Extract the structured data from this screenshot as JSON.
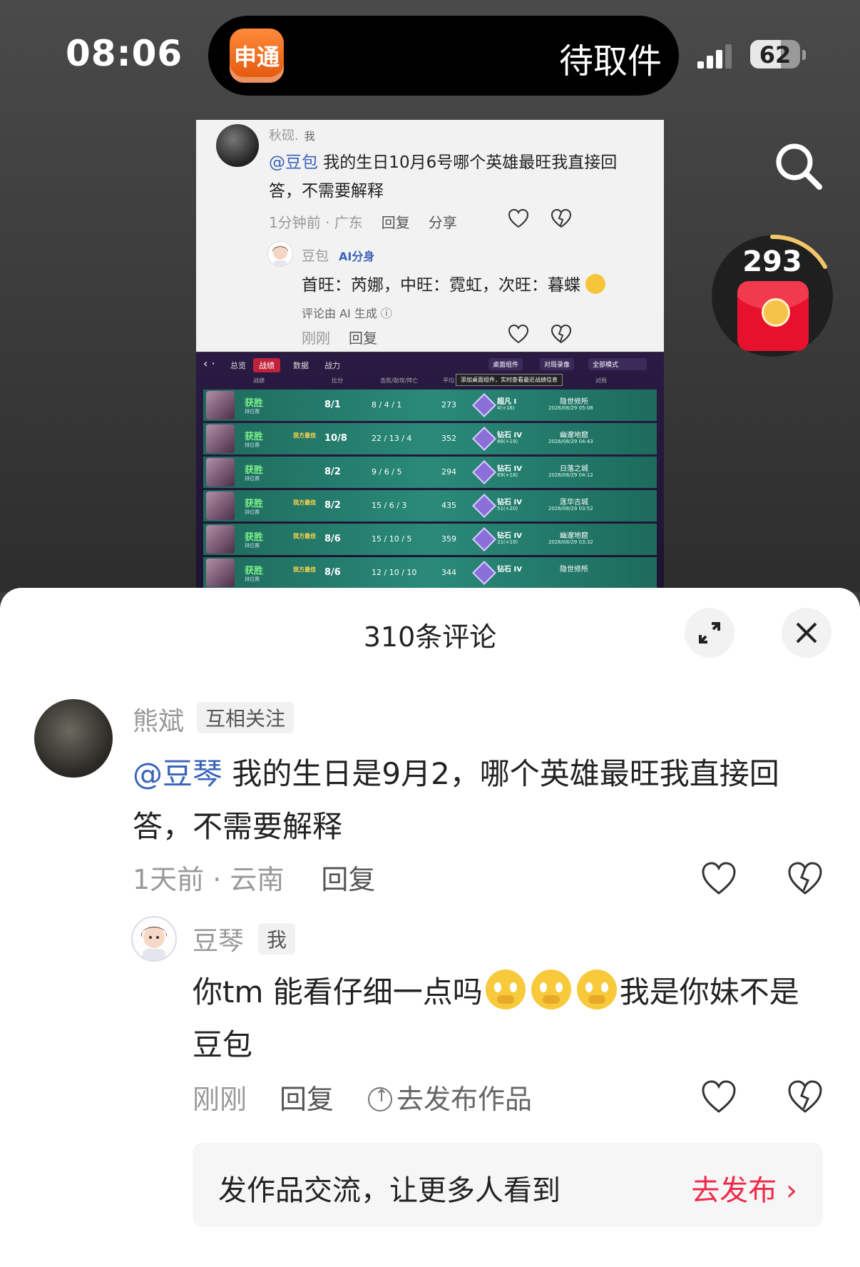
{
  "status_bar": {
    "time": "08:06",
    "island_app": "申通",
    "island_text": "待取件",
    "battery": "62"
  },
  "red_packet": {
    "count": "293"
  },
  "embedded_post": {
    "user": "秋砚.",
    "user_tag": "我",
    "mention": "@豆包",
    "text": " 我的生日10月6号哪个英雄最旺我直接回答，不需要解释",
    "meta_time": "1分钟前 · 广东",
    "reply_label": "回复",
    "share_label": "分享",
    "reply": {
      "name": "豆包",
      "ai_tag": "AI分身",
      "text": "首旺：芮娜，中旺：霓虹，次旺：暮蝶",
      "ai_note": "评论由 AI 生成 ⓘ",
      "time": "刚刚",
      "reply_label": "回复"
    }
  },
  "game": {
    "tabs": [
      "总览",
      "战绩",
      "数据",
      "战力"
    ],
    "active_tab": "战绩",
    "right_buttons": [
      "桌面组件",
      "对局录像",
      "全部模式"
    ],
    "headers": [
      "战绩",
      "比分",
      "击败/助攻/阵亡",
      "平均",
      "对局"
    ],
    "tooltip": "添加桌面组件，实时查看最近战绩信息",
    "rows": [
      {
        "result": "获胜",
        "mode": "排位赛",
        "mvp": "",
        "score": "8/1",
        "kda": "8 / 4 / 1",
        "value": "273",
        "rank": "超凡 I",
        "rank_detail": "4(+16)",
        "map": "隐世修所",
        "date": "2026/08/29 05:08"
      },
      {
        "result": "获胜",
        "mode": "排位赛",
        "mvp": "我方最佳",
        "score": "10/8",
        "kda": "22 / 13 / 4",
        "value": "352",
        "rank": "钻石 IV",
        "rank_detail": "88(+19)",
        "map": "幽邃地窟",
        "date": "2026/08/29 04:43"
      },
      {
        "result": "获胜",
        "mode": "排位赛",
        "mvp": "",
        "score": "8/2",
        "kda": "9 / 6 / 5",
        "value": "294",
        "rank": "钻石 IV",
        "rank_detail": "69(+18)",
        "map": "日落之城",
        "date": "2026/08/29 04:12"
      },
      {
        "result": "获胜",
        "mode": "排位赛",
        "mvp": "我方最佳",
        "score": "8/2",
        "kda": "15 / 6 / 3",
        "value": "435",
        "rank": "钻石 IV",
        "rank_detail": "51(+20)",
        "map": "莲华古城",
        "date": "2026/08/29 03:52"
      },
      {
        "result": "获胜",
        "mode": "排位赛",
        "mvp": "我方最佳",
        "score": "8/6",
        "kda": "15 / 10 / 5",
        "value": "359",
        "rank": "钻石 IV",
        "rank_detail": "31(+19)",
        "map": "幽邃地窟",
        "date": "2026/08/29 03:32"
      },
      {
        "result": "获胜",
        "mode": "排位赛",
        "mvp": "我方最佳",
        "score": "8/6",
        "kda": "12 / 10 / 10",
        "value": "344",
        "rank": "钻石 IV",
        "rank_detail": "",
        "map": "隐世修所",
        "date": ""
      }
    ]
  },
  "comments_sheet": {
    "title": "310条评论",
    "main_comment": {
      "user": "熊斌",
      "tag": "互相关注",
      "mention": "@豆琴",
      "text": " 我的生日是9月2，哪个英雄最旺我直接回答，不需要解释",
      "meta": "1天前 · 云南",
      "reply_label": "回复"
    },
    "reply_comment": {
      "user": "豆琴",
      "tag": "我",
      "text_a": "你tm 能看仔细一点吗",
      "text_b": "我是你妹不是豆包",
      "time": "刚刚",
      "reply_label": "回复",
      "publish_label": "去发布作品"
    },
    "banner": {
      "text": "发作品交流，让更多人看到",
      "button": "去发布 ›"
    }
  }
}
